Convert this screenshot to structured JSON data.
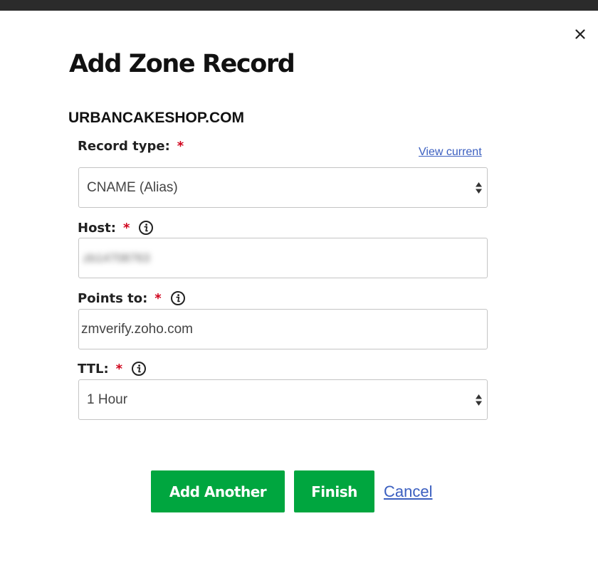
{
  "dialog": {
    "title": "Add Zone Record",
    "domain": "URBANCAKESHOP.COM",
    "close_glyph": "×",
    "close_icon": "close-icon"
  },
  "fields": {
    "record_type": {
      "label": "Record type:",
      "required_mark": "*",
      "view_current": "View current",
      "selected": "CNAME (Alias)"
    },
    "host": {
      "label": "Host:",
      "required_mark": "*",
      "info_icon": "info-icon",
      "value": "zb14708763"
    },
    "points_to": {
      "label": "Points to:",
      "required_mark": "*",
      "info_icon": "info-icon",
      "value": "zmverify.zoho.com"
    },
    "ttl": {
      "label": "TTL:",
      "required_mark": "*",
      "info_icon": "info-icon",
      "selected": "1 Hour"
    }
  },
  "actions": {
    "add_another": "Add Another",
    "finish": "Finish",
    "cancel": "Cancel"
  },
  "colors": {
    "primary_green": "#00a63f",
    "link_blue": "#3b5fc0",
    "required_red": "#d0021b",
    "top_bar": "#2b2b2b"
  }
}
